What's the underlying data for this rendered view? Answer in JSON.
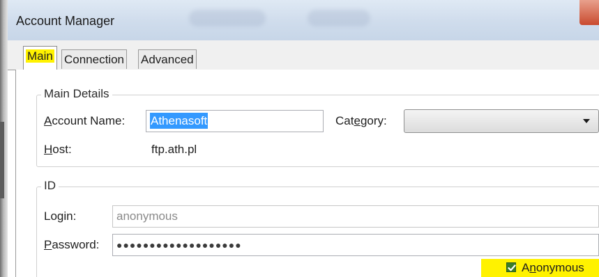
{
  "window": {
    "title": "Account Manager"
  },
  "tabs": [
    {
      "label": "Main",
      "active": true
    },
    {
      "label": "Connection",
      "active": false
    },
    {
      "label": "Advanced",
      "active": false
    }
  ],
  "main_details": {
    "group_label": "Main Details",
    "account_name_label_pre": "",
    "account_name_label_acc": "A",
    "account_name_label_post": "ccount Name:",
    "account_name_value": "Athenasoft",
    "category_label_pre": "Cat",
    "category_label_acc": "e",
    "category_label_post": "gory:",
    "category_value": "",
    "host_label_pre": "",
    "host_label_acc": "H",
    "host_label_post": "ost:",
    "host_value": "ftp.ath.pl"
  },
  "id_group": {
    "group_label": "ID",
    "login_label_pre": "Lo",
    "login_label_acc": "g",
    "login_label_post": "in:",
    "login_value": "anonymous",
    "password_label_pre": "",
    "password_label_acc": "P",
    "password_label_post": "assword:",
    "password_value": "●●●●●●●●●●●●●●●●●●●",
    "anonymous_label_pre": "A",
    "anonymous_label_acc": "n",
    "anonymous_label_post": "onymous",
    "anonymous_checked": true
  },
  "colors": {
    "highlight": "#fff200",
    "selection": "#3399ff",
    "checkbox_green": "#3a7d2a"
  },
  "icons": {
    "close": "close-icon",
    "dropdown": "chevron-down-icon",
    "check": "check-icon"
  }
}
